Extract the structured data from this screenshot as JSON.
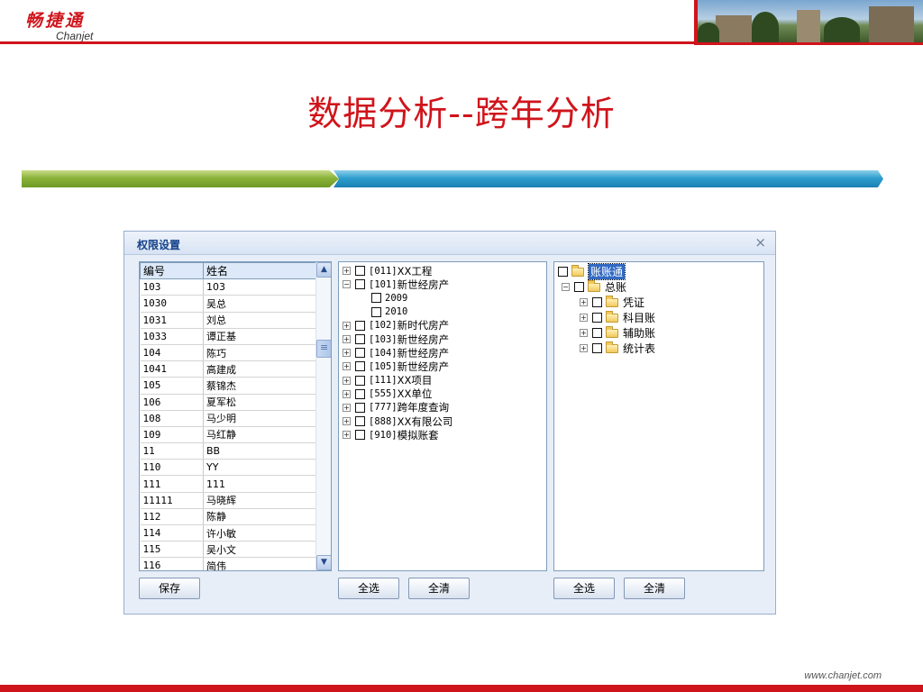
{
  "brand": {
    "name_cn": "畅捷通",
    "name_en": "Chanjet",
    "url": "www.chanjet.com",
    "color": "#d0141b"
  },
  "slide_title": "数据分析--跨年分析",
  "dialog": {
    "title": "权限设置",
    "close_glyph": "×",
    "users": {
      "columns": [
        "编号",
        "姓名"
      ],
      "rows": [
        [
          "103",
          "103"
        ],
        [
          "1030",
          "吴总"
        ],
        [
          "1031",
          "刘总"
        ],
        [
          "1033",
          "谭正基"
        ],
        [
          "104",
          "陈巧"
        ],
        [
          "1041",
          "高建成"
        ],
        [
          "105",
          "蔡锦杰"
        ],
        [
          "106",
          "夏军松"
        ],
        [
          "108",
          "马少明"
        ],
        [
          "109",
          "马红静"
        ],
        [
          "11",
          "BB"
        ],
        [
          "110",
          "YY"
        ],
        [
          "111",
          "111"
        ],
        [
          "11111",
          "马晓辉"
        ],
        [
          "112",
          "陈静"
        ],
        [
          "114",
          "许小敏"
        ],
        [
          "115",
          "吴小文"
        ],
        [
          "116",
          "简伟"
        ]
      ],
      "save_label": "保存"
    },
    "accounts": {
      "items": [
        {
          "expander": "+",
          "code": "[011]",
          "name": "XX工程",
          "level": 0
        },
        {
          "expander": "−",
          "code": "[101]",
          "name": "新世经房产",
          "level": 0
        },
        {
          "expander": "",
          "code": "",
          "name": "2009",
          "level": 1
        },
        {
          "expander": "",
          "code": "",
          "name": "2010",
          "level": 1
        },
        {
          "expander": "+",
          "code": "[102]",
          "name": "新时代房产",
          "level": 0
        },
        {
          "expander": "+",
          "code": "[103]",
          "name": "新世经房产",
          "level": 0
        },
        {
          "expander": "+",
          "code": "[104]",
          "name": "新世经房产",
          "level": 0
        },
        {
          "expander": "+",
          "code": "[105]",
          "name": "新世经房产",
          "level": 0
        },
        {
          "expander": "+",
          "code": "[111]",
          "name": "XX项目",
          "level": 0
        },
        {
          "expander": "+",
          "code": "[555]",
          "name": "XX单位",
          "level": 0
        },
        {
          "expander": "+",
          "code": "[777]",
          "name": "跨年度查询",
          "level": 0
        },
        {
          "expander": "+",
          "code": "[888]",
          "name": "XX有限公司",
          "level": 0
        },
        {
          "expander": "+",
          "code": "[910]",
          "name": "模拟账套",
          "level": 0
        }
      ],
      "select_all_label": "全选",
      "clear_all_label": "全清"
    },
    "permissions": {
      "root": "账账通",
      "level1": {
        "expander": "−",
        "name": "总账"
      },
      "level2": [
        {
          "expander": "+",
          "name": "凭证"
        },
        {
          "expander": "+",
          "name": "科目账"
        },
        {
          "expander": "+",
          "name": "辅助账"
        },
        {
          "expander": "+",
          "name": "统计表"
        }
      ],
      "select_all_label": "全选",
      "clear_all_label": "全清"
    }
  }
}
